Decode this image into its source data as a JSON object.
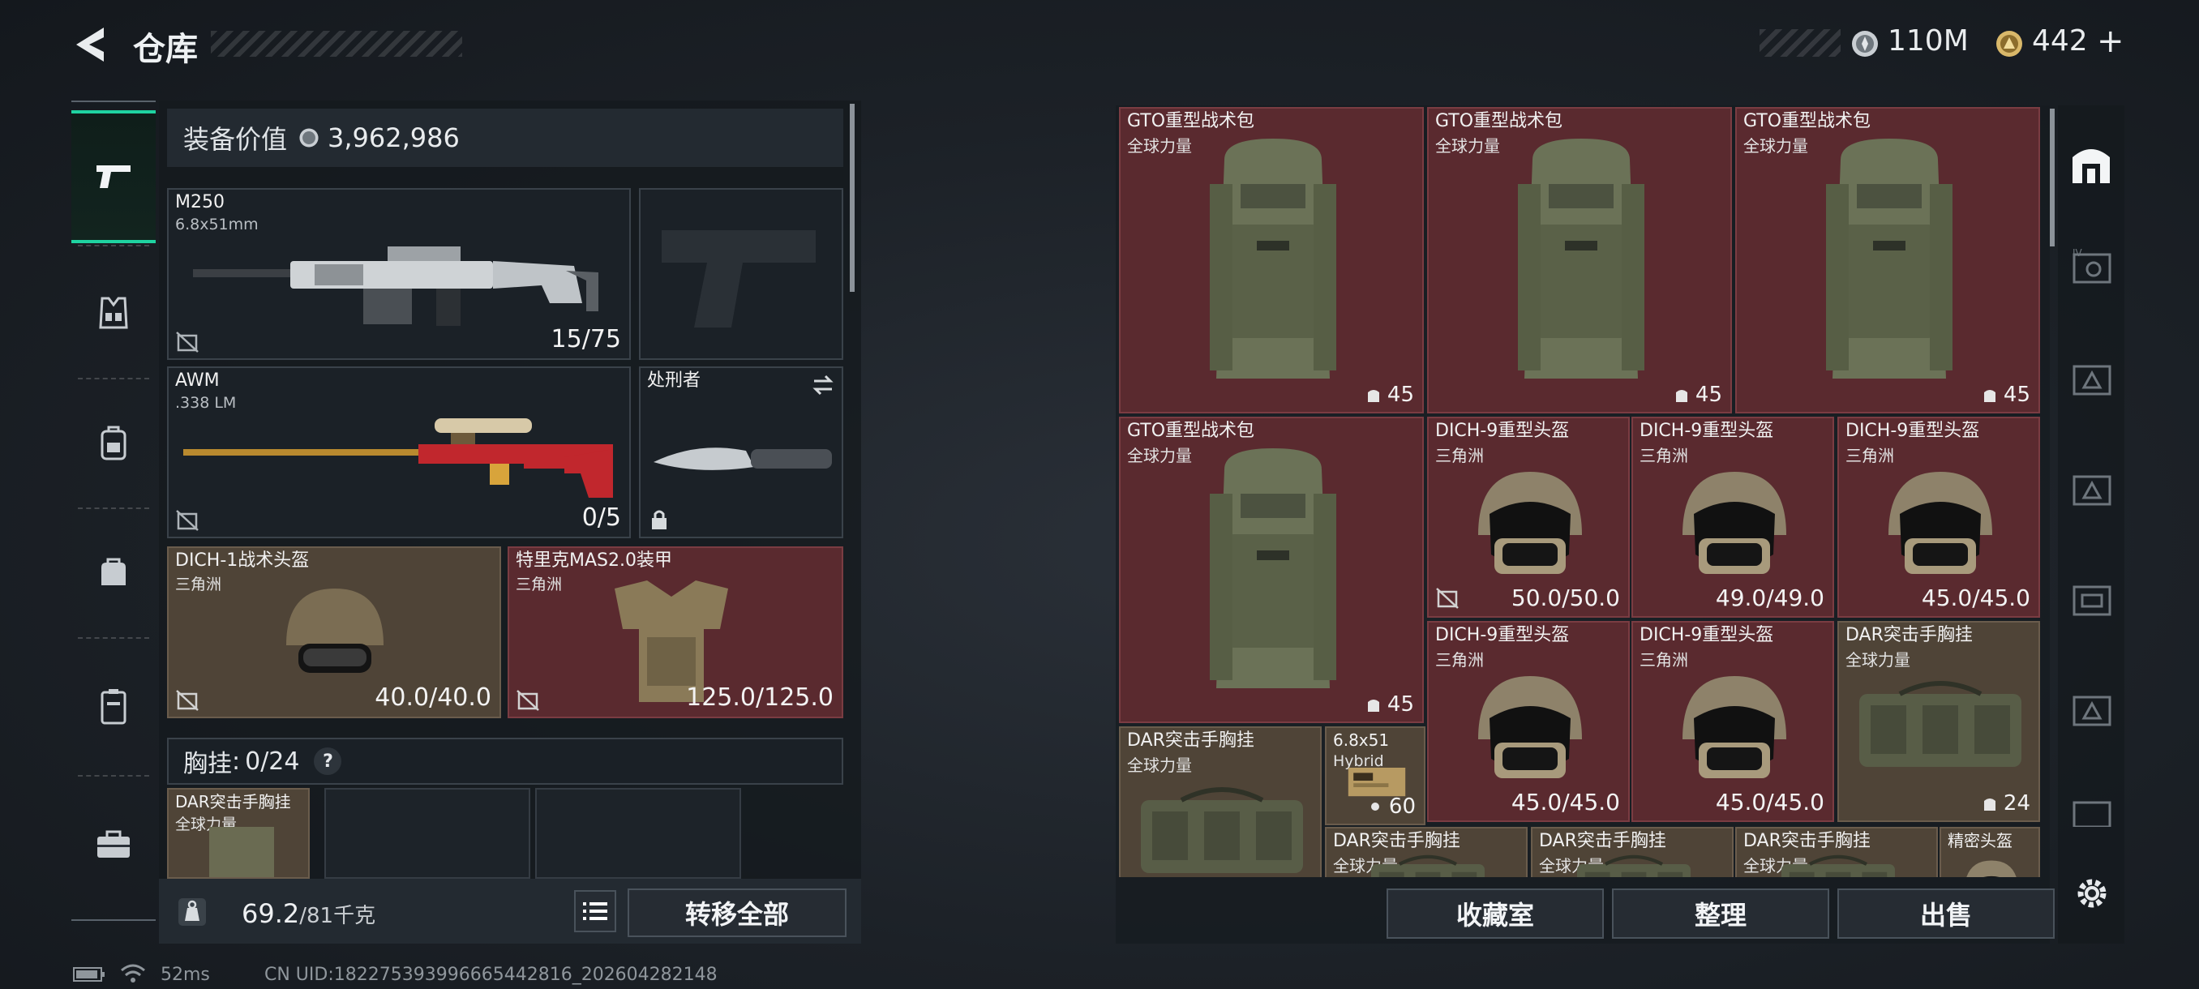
{
  "header": {
    "title": "仓库",
    "currency_silver": "110M",
    "currency_gold": "442",
    "gold_plus": "+",
    "back_icon": "chevron-left-icon"
  },
  "left_nav": {
    "items": [
      {
        "icon": "gun-icon",
        "active": true
      },
      {
        "icon": "vest-icon",
        "active": false
      },
      {
        "icon": "backpack-icon",
        "active": false
      },
      {
        "icon": "bag-icon",
        "active": false
      },
      {
        "icon": "case-icon",
        "active": false
      },
      {
        "icon": "toolbox-icon",
        "active": false
      }
    ]
  },
  "equipment": {
    "value_label": "装备价值",
    "value": "3,962,986",
    "slots": {
      "primary": {
        "name": "M250",
        "caliber": "6.8x51mm",
        "ammo": "15/75"
      },
      "pistol": {
        "name": ""
      },
      "secondary": {
        "name": "AWM",
        "caliber": ".338 LM",
        "ammo": "0/5"
      },
      "melee": {
        "name": "处刑者"
      },
      "helmet": {
        "name": "DICH-1战术头盔",
        "region": "三角洲",
        "durability": "40.0/40.0"
      },
      "armor": {
        "name": "特里克MAS2.0装甲",
        "region": "三角洲",
        "durability": "125.0/125.0"
      }
    },
    "rig_label": "胸挂",
    "rig_capacity": "0/24",
    "rig_help": "?",
    "rig_item": {
      "name": "DAR突击手胸挂",
      "region": "全球力量"
    }
  },
  "footer_left": {
    "weight_current": "69.2",
    "weight_max": "/81千克",
    "transfer_all": "转移全部"
  },
  "storage": {
    "items": [
      {
        "name": "GTO重型战术包",
        "region": "全球力量",
        "count": "45"
      },
      {
        "name": "GTO重型战术包",
        "region": "全球力量",
        "count": "45"
      },
      {
        "name": "GTO重型战术包",
        "region": "全球力量",
        "count": "45"
      },
      {
        "name": "GTO重型战术包",
        "region": "全球力量",
        "count": "45"
      },
      {
        "name": "DICH-9重型头盔",
        "region": "三角洲",
        "durability": "50.0/50.0"
      },
      {
        "name": "DICH-9重型头盔",
        "region": "三角洲",
        "durability": "49.0/49.0"
      },
      {
        "name": "DICH-9重型头盔",
        "region": "三角洲",
        "durability": "45.0/45.0"
      },
      {
        "name": "DICH-9重型头盔",
        "region": "三角洲",
        "durability": "45.0/45.0"
      },
      {
        "name": "DICH-9重型头盔",
        "region": "三角洲",
        "durability": "45.0/45.0"
      },
      {
        "name": "DAR突击手胸挂",
        "region": "全球力量",
        "count": "24"
      },
      {
        "name": "DAR突击手胸挂",
        "region": "全球力量"
      },
      {
        "name": "6.8x51",
        "region": "Hybrid",
        "count": "60"
      },
      {
        "name": "DAR突击手胸挂",
        "region": "全球力量"
      },
      {
        "name": "DAR突击手胸挂",
        "region": "全球力量"
      },
      {
        "name": "DAR突击手胸挂",
        "region": "全球力量"
      },
      {
        "name": "精密头盔",
        "region": ""
      }
    ],
    "buttons": {
      "collection": "收藏室",
      "organize": "整理",
      "sell": "出售"
    }
  },
  "status_bar": {
    "ping": "52ms",
    "uid": "CN UID:1822753939966654428‌16_202604282148"
  },
  "colors": {
    "accent": "#1fd3a1",
    "red_cell": "#5a2a2f",
    "brown_cell": "#4f4437"
  }
}
